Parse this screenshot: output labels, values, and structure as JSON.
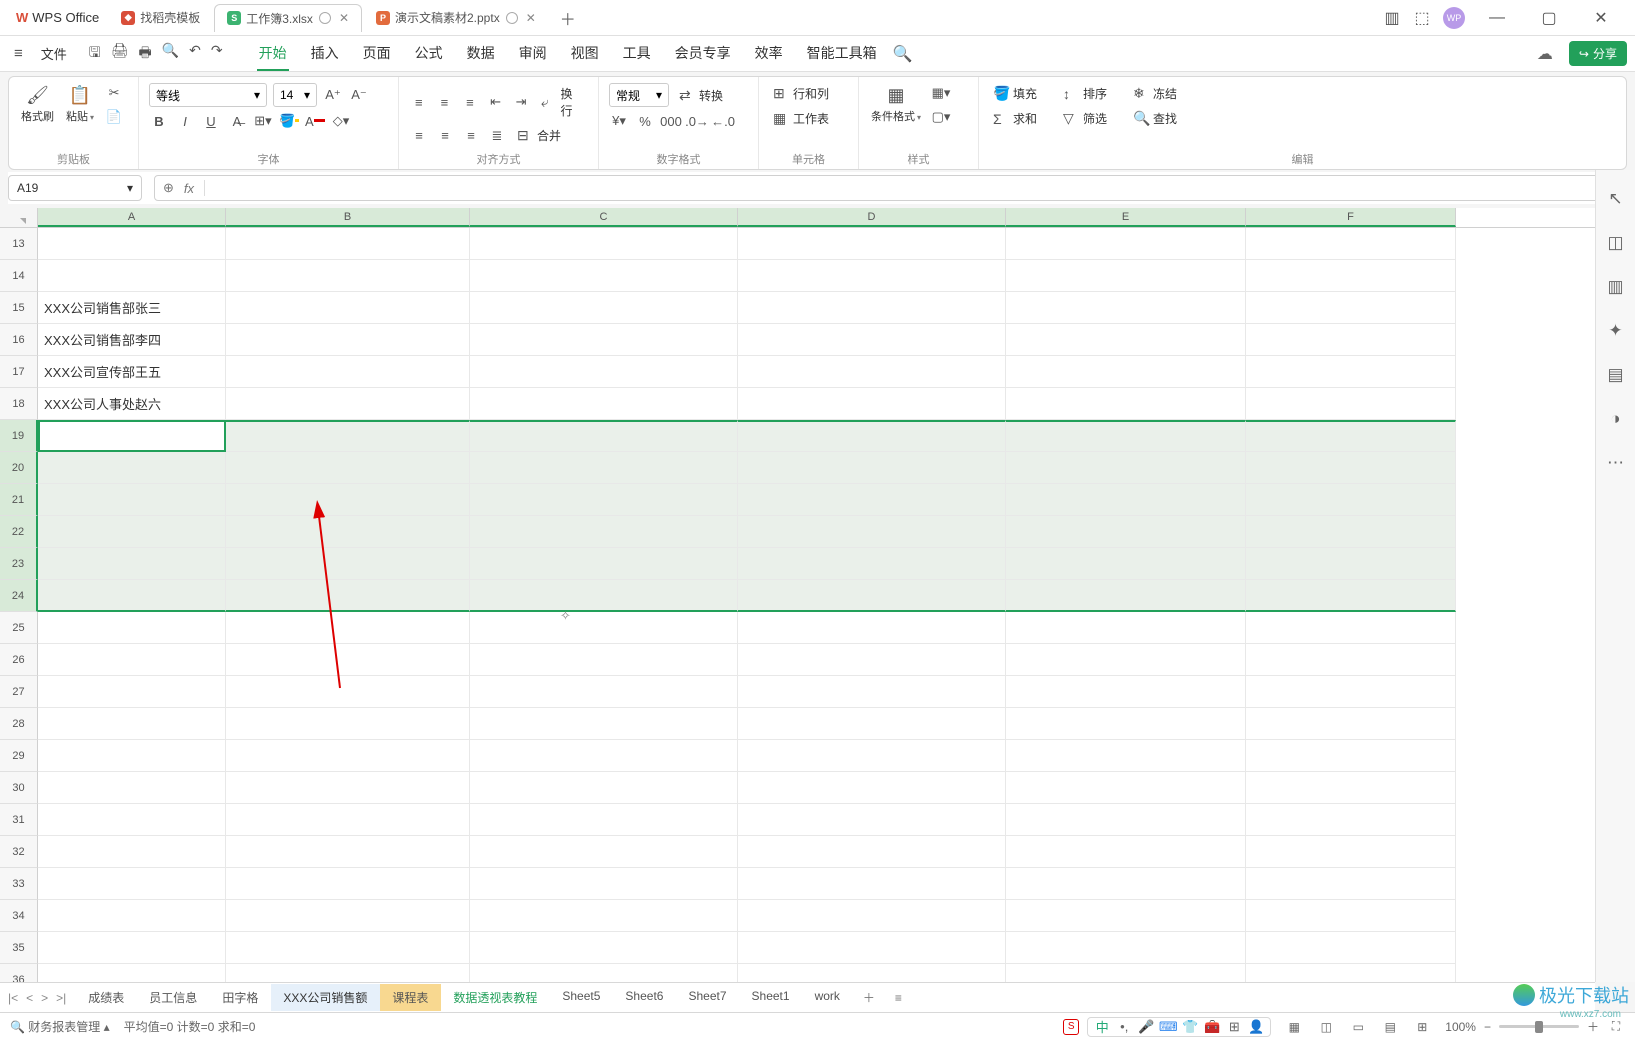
{
  "titlebar": {
    "app_name": "WPS Office",
    "tabs": [
      {
        "label": "找稻壳模板",
        "type": "doc"
      },
      {
        "label": "工作簿3.xlsx",
        "type": "sheet",
        "active": true
      },
      {
        "label": "演示文稿素材2.pptx",
        "type": "ppt"
      }
    ],
    "avatar_text": "WP"
  },
  "menubar": {
    "file": "文件",
    "tabs": [
      "开始",
      "插入",
      "页面",
      "公式",
      "数据",
      "审阅",
      "视图",
      "工具",
      "会员专享",
      "效率",
      "智能工具箱"
    ],
    "active_index": 0,
    "share": "分享"
  },
  "ribbon": {
    "groups": {
      "clipboard": {
        "label": "剪贴板",
        "format_painter": "格式刷",
        "paste": "粘贴"
      },
      "font": {
        "label": "字体",
        "font_name": "等线",
        "font_size": "14"
      },
      "align": {
        "label": "对齐方式",
        "wrap": "换行",
        "merge": "合并"
      },
      "number": {
        "label": "数字格式",
        "general": "常规",
        "convert": "转换"
      },
      "cells": {
        "label": "单元格",
        "rowscols": "行和列",
        "worksheet": "工作表"
      },
      "styles": {
        "label": "样式",
        "cond": "条件格式"
      },
      "editing": {
        "label": "编辑",
        "fill": "填充",
        "sort": "排序",
        "freeze": "冻结",
        "sum": "求和",
        "filter": "筛选",
        "find": "查找"
      }
    }
  },
  "namebox": {
    "ref": "A19"
  },
  "columns": [
    "A",
    "B",
    "C",
    "D",
    "E",
    "F"
  ],
  "rows_start": 13,
  "rows_end": 36,
  "cells": {
    "A15": "XXX公司销售部张三",
    "A16": "XXX公司销售部李四",
    "A17": "XXX公司宣传部王五",
    "A18": "XXX公司人事处赵六"
  },
  "active_cell": "A19",
  "selection_rows": [
    19,
    20,
    21,
    22,
    23,
    24
  ],
  "sheet_tabs": {
    "items": [
      {
        "label": "成绩表"
      },
      {
        "label": "员工信息"
      },
      {
        "label": "田字格"
      },
      {
        "label": "XXX公司销售额",
        "active": true
      },
      {
        "label": "课程表",
        "warn": true
      },
      {
        "label": "数据透视表教程",
        "green": true
      },
      {
        "label": "Sheet5"
      },
      {
        "label": "Sheet6"
      },
      {
        "label": "Sheet7"
      },
      {
        "label": "Sheet1"
      },
      {
        "label": "work"
      }
    ]
  },
  "statusbar": {
    "mgr": "财务报表管理",
    "stats": "平均值=0  计数=0  求和=0",
    "ime_zh": "中",
    "zoom": "100%"
  },
  "watermark": {
    "main": "极光下载站",
    "sub": "www.xz7.com"
  }
}
